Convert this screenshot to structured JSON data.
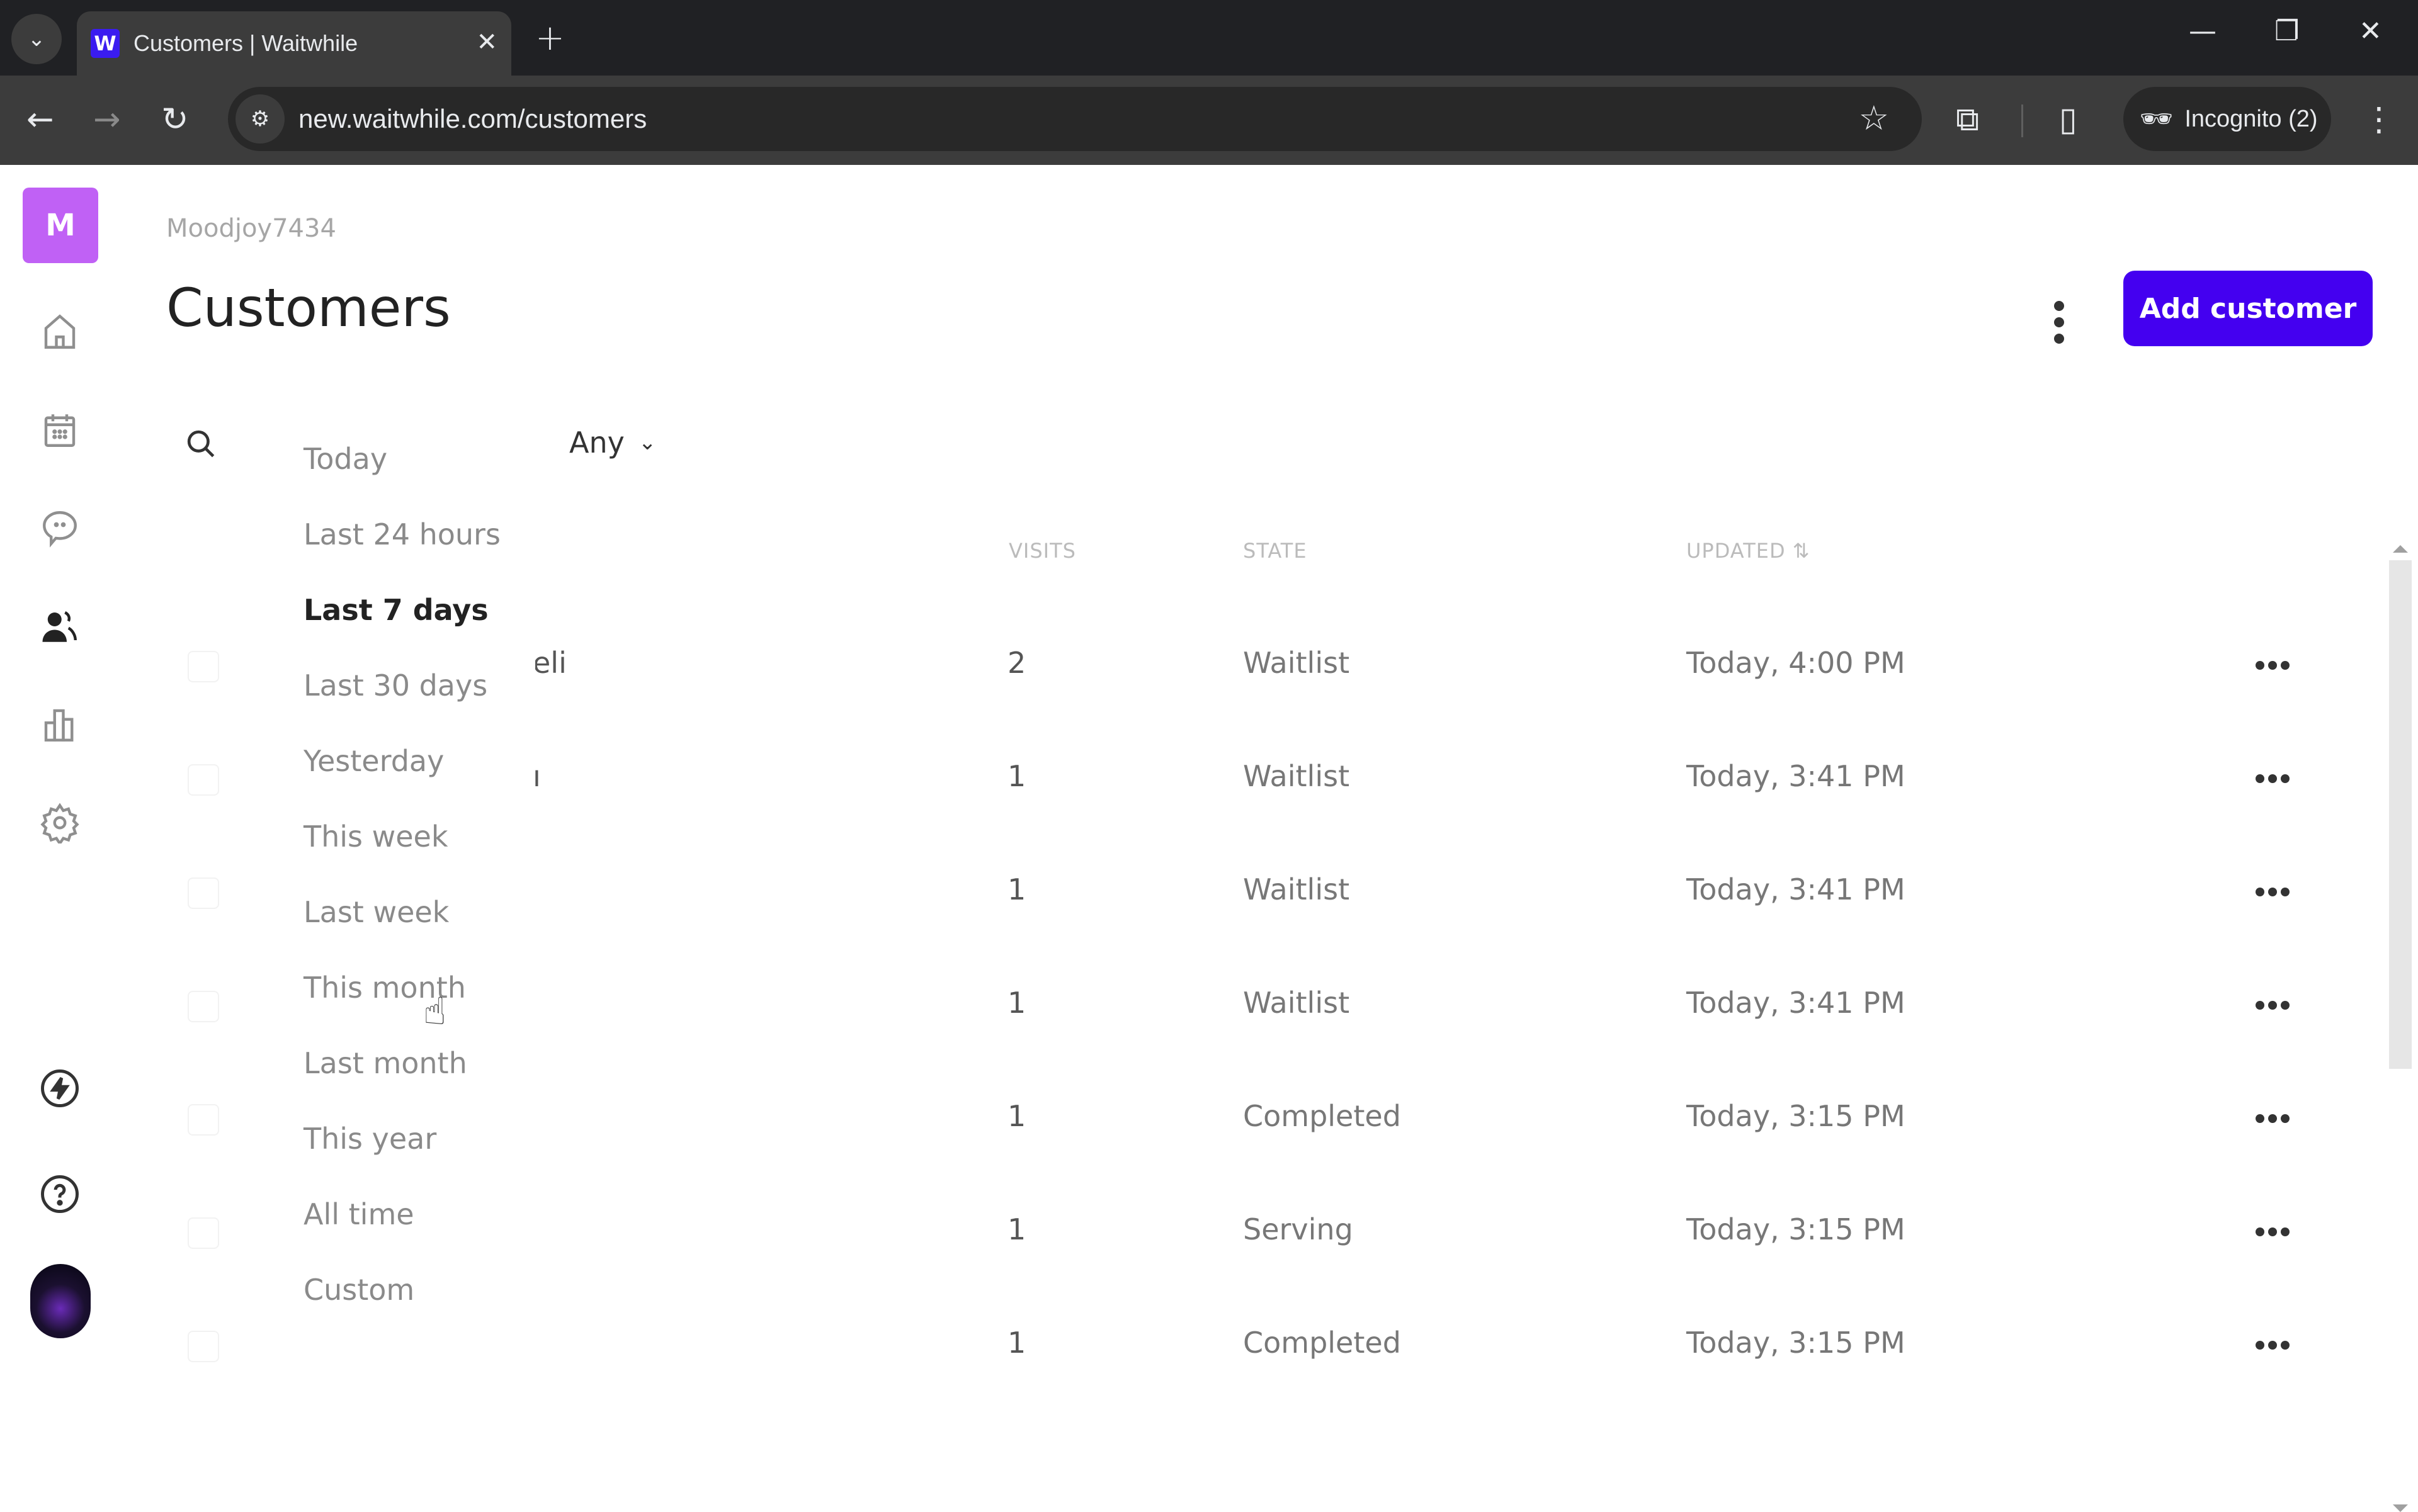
{
  "browser": {
    "tab_title": "Customers | Waitwhile",
    "favicon_letter": "W",
    "url": "new.waitwhile.com/customers",
    "incognito_label": "Incognito (2)",
    "icons": {
      "tab_search": "chevron-down-icon",
      "close_tab": "close-icon",
      "new_tab": "plus-icon",
      "minimize": "minimize-icon",
      "restore": "restore-icon",
      "close_window": "close-icon",
      "back": "back-arrow-icon",
      "forward": "forward-arrow-icon",
      "reload": "reload-icon",
      "site_info": "tune-icon",
      "bookmark": "star-icon",
      "extensions": "puzzle-icon",
      "side_panel": "side-panel-icon",
      "incognito": "incognito-icon",
      "menu": "kebab-icon"
    },
    "glyphs": {
      "tab_search": "⌄",
      "close_tab": "✕",
      "new_tab": "+",
      "minimize": "—",
      "restore": "❐",
      "close_window": "✕",
      "back": "←",
      "forward": "→",
      "reload": "↻",
      "site_info": "⚙",
      "bookmark": "☆",
      "extensions": "⧉",
      "side_panel": "▯",
      "incognito": "🕶",
      "menu": "⋮"
    }
  },
  "sidebar": {
    "org_initial": "M",
    "items": [
      {
        "name": "home",
        "icon": "home-icon"
      },
      {
        "name": "calendar",
        "icon": "calendar-icon"
      },
      {
        "name": "messages",
        "icon": "chat-icon"
      },
      {
        "name": "customers",
        "icon": "users-icon",
        "active": true
      },
      {
        "name": "analytics",
        "icon": "bar-chart-icon"
      },
      {
        "name": "settings",
        "icon": "gear-icon"
      }
    ],
    "bottom": [
      {
        "name": "whats-new",
        "icon": "lightning-icon"
      },
      {
        "name": "help",
        "icon": "help-icon"
      },
      {
        "name": "profile",
        "icon": "avatar"
      }
    ]
  },
  "header": {
    "org_name": "Moodjoy7434",
    "title": "Customers",
    "add_button": "Add customer"
  },
  "filters": {
    "any_label": "Any"
  },
  "date_menu": {
    "items": [
      "Today",
      "Last 24 hours",
      "Last 7 days",
      "Last 30 days",
      "Yesterday",
      "This week",
      "Last week",
      "This month",
      "Last month",
      "This year",
      "All time",
      "Custom"
    ],
    "selected": "Last 7 days"
  },
  "table": {
    "columns": [
      "VISITS",
      "STATE",
      "UPDATED"
    ],
    "sort_glyph": "⇅",
    "rows": [
      {
        "name_fragment": "eli",
        "visits": "2",
        "state": "Waitlist",
        "updated": "Today, 4:00 PM"
      },
      {
        "name_fragment": "ı",
        "visits": "1",
        "state": "Waitlist",
        "updated": "Today, 3:41 PM"
      },
      {
        "name_fragment": "",
        "visits": "1",
        "state": "Waitlist",
        "updated": "Today, 3:41 PM"
      },
      {
        "name_fragment": "",
        "visits": "1",
        "state": "Waitlist",
        "updated": "Today, 3:41 PM"
      },
      {
        "name_fragment": "",
        "visits": "1",
        "state": "Completed",
        "updated": "Today, 3:15 PM"
      },
      {
        "name_fragment": "",
        "visits": "1",
        "state": "Serving",
        "updated": "Today, 3:15 PM"
      },
      {
        "name_fragment": "",
        "visits": "1",
        "state": "Completed",
        "updated": "Today, 3:15 PM"
      }
    ]
  },
  "colors": {
    "brand": "#4400f0",
    "org_avatar": "#c061f5"
  }
}
